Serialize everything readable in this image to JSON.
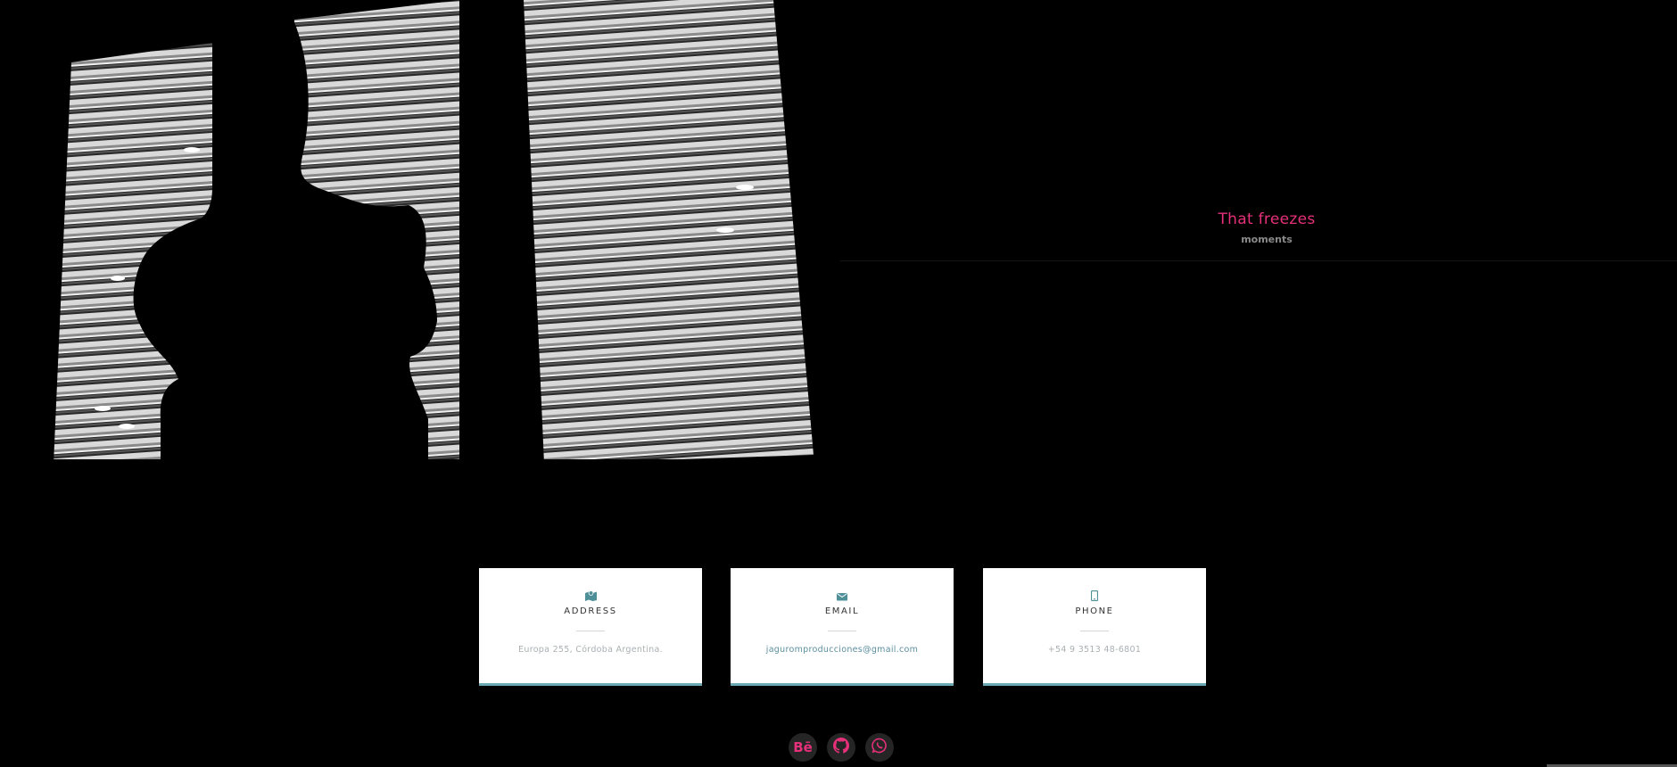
{
  "hero": {
    "title": "That freezes",
    "subtitle": "moments"
  },
  "contact_cards": [
    {
      "icon": "map-icon",
      "label": "ADDRESS",
      "value": "Europa 255, Córdoba Argentina."
    },
    {
      "icon": "envelope-icon",
      "label": "EMAIL",
      "value": "jaguromproducciones@gmail.com"
    },
    {
      "icon": "phone-icon",
      "label": "PHONE",
      "value": "+54 9 3513 48-6801"
    }
  ],
  "social": [
    {
      "icon": "behance-icon",
      "text": "Bē"
    },
    {
      "icon": "github-icon"
    },
    {
      "icon": "whatsapp-icon"
    }
  ],
  "colors": {
    "accent": "#e5307a",
    "card_border": "#6aa8b4",
    "icon_teal": "#4e8f98",
    "background": "#000000"
  }
}
